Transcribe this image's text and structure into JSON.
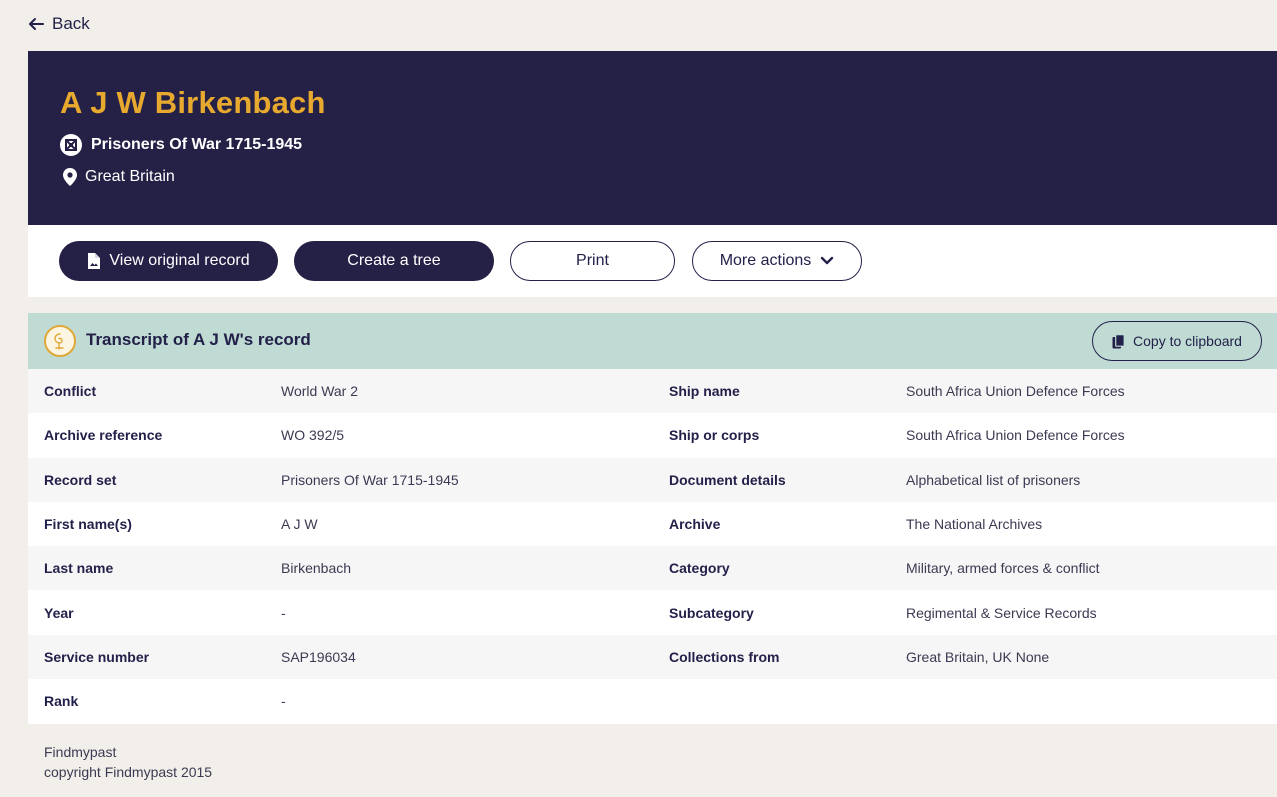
{
  "nav": {
    "back_label": "Back"
  },
  "record": {
    "name": "A J W Birkenbach",
    "collection": "Prisoners Of War 1715-1945",
    "location": "Great Britain"
  },
  "actions": {
    "view_original": "View original record",
    "create_tree": "Create a tree",
    "print": "Print",
    "more_actions": "More actions"
  },
  "transcript": {
    "title": "Transcript of A J W's record",
    "copy_label": "Copy to clipboard",
    "rows": [
      {
        "label_left": "Conflict",
        "value_left": "World War 2",
        "label_right": "Ship name",
        "value_right": "South Africa Union Defence Forces"
      },
      {
        "label_left": "Archive reference",
        "value_left": "WO 392/5",
        "label_right": "Ship or corps",
        "value_right": "South Africa Union Defence Forces"
      },
      {
        "label_left": "Record set",
        "value_left": "Prisoners Of War 1715-1945",
        "label_right": "Document details",
        "value_right": "Alphabetical list of prisoners"
      },
      {
        "label_left": "First name(s)",
        "value_left": "A J W",
        "label_right": "Archive",
        "value_right": "The National Archives"
      },
      {
        "label_left": "Last name",
        "value_left": "Birkenbach",
        "label_right": "Category",
        "value_right": "Military, armed forces & conflict"
      },
      {
        "label_left": "Year",
        "value_left": "-",
        "label_right": "Subcategory",
        "value_right": "Regimental & Service Records"
      },
      {
        "label_left": "Service number",
        "value_left": "SAP196034",
        "label_right": "Collections from",
        "value_right": "Great Britain, UK None"
      },
      {
        "label_left": "Rank",
        "value_left": "-",
        "label_right": "",
        "value_right": ""
      }
    ]
  },
  "footer": {
    "line1": "Findmypast",
    "line2": "copyright Findmypast 2015"
  },
  "colors": {
    "navy": "#252046",
    "gold": "#e8a92f",
    "teal_header": "#bfdbd3",
    "page_bg": "#f2efea"
  },
  "icons": {
    "back": "arrow-left-icon",
    "collection": "crest-icon",
    "location": "map-pin-icon",
    "view_original": "document-image-icon",
    "more_actions": "chevron-down-icon",
    "transcript": "transcript-badge-icon",
    "copy": "copy-icon"
  }
}
